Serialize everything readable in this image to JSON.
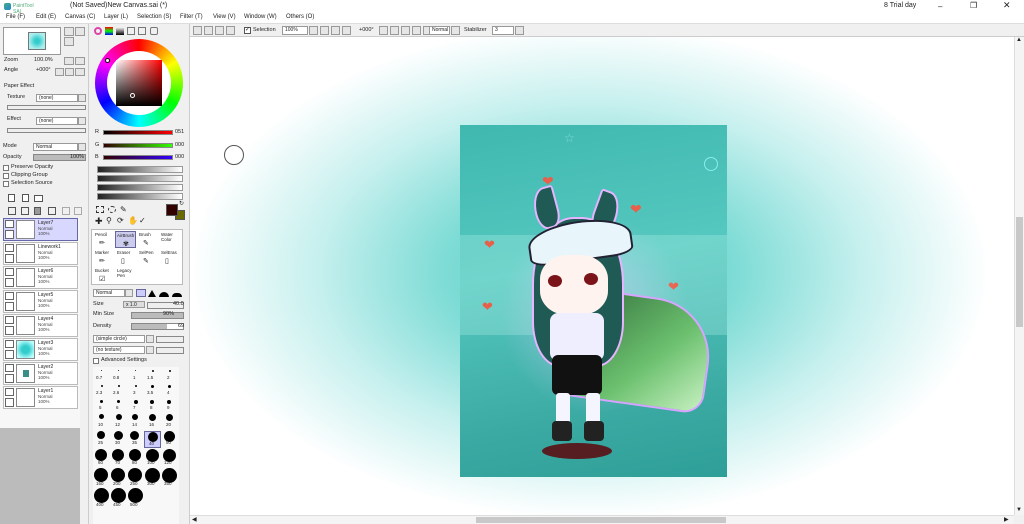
{
  "window": {
    "app_logo": "PaintTool SAI",
    "title": "(Not Saved)New Canvas.sai (*)",
    "trial": "8 Trial day"
  },
  "menu": [
    "File (F)",
    "Edit (E)",
    "Canvas (C)",
    "Layer (L)",
    "Selection (S)",
    "Filter (T)",
    "View (V)",
    "Window (W)",
    "Others (O)"
  ],
  "navigator": {
    "zoom_label": "Zoom",
    "zoom_value": "100.0%",
    "angle_label": "Angle",
    "angle_value": "+000°"
  },
  "paper_effect": {
    "header": "Paper Effect",
    "texture_label": "Texture",
    "texture_value": "(none)",
    "effect_label": "Effect",
    "effect_value": "(none)"
  },
  "layer_props": {
    "mode_label": "Mode",
    "mode_value": "Normal",
    "opacity_label": "Opacity",
    "opacity_value": "100%",
    "preserve_opacity": "Preserve Opacity",
    "clipping_group": "Clipping Group",
    "selection_source": "Selection Source"
  },
  "layers": [
    {
      "name": "Layer7",
      "mode": "Normal",
      "opacity": "100%",
      "selected": true
    },
    {
      "name": "Linework1",
      "mode": "Normal",
      "opacity": "100%"
    },
    {
      "name": "Layer6",
      "mode": "Normal",
      "opacity": "100%"
    },
    {
      "name": "Layer5",
      "mode": "Normal",
      "opacity": "100%"
    },
    {
      "name": "Layer4",
      "mode": "Normal",
      "opacity": "100%"
    },
    {
      "name": "Layer3",
      "mode": "Normal",
      "opacity": "100%"
    },
    {
      "name": "Layer2",
      "mode": "Normal",
      "opacity": "100%"
    },
    {
      "name": "Layer1",
      "mode": "Normal",
      "opacity": "100%"
    }
  ],
  "color": {
    "r_label": "R",
    "r_value": "051",
    "g_label": "G",
    "g_value": "000",
    "b_label": "B",
    "b_value": "000",
    "fg": "#330000"
  },
  "tools": [
    [
      "Pencil",
      "AirBrush",
      "Brush",
      "Water Color"
    ],
    [
      "Marker",
      "Eraser",
      "SelPen",
      "SelEras"
    ],
    [
      "Bucket",
      "Legacy Pen"
    ]
  ],
  "brush": {
    "mode_value": "Normal",
    "size_label": "Size",
    "size_mult": "x 1.0",
    "size_value": "40.0",
    "min_size_label": "Min Size",
    "min_size_value": "90%",
    "density_label": "Density",
    "density_value": "69",
    "shape_value": "(simple circle)",
    "texture_value": "(no texture)",
    "advanced": "Advanced Settings"
  },
  "brush_sizes": [
    [
      "0.7",
      "0.8",
      "1",
      "1.5",
      "2"
    ],
    [
      "2.3",
      "2.6",
      "3",
      "3.5",
      "4"
    ],
    [
      "5",
      "6",
      "7",
      "8",
      "9"
    ],
    [
      "10",
      "12",
      "14",
      "16",
      "20"
    ],
    [
      "25",
      "30",
      "35",
      "40",
      "50"
    ],
    [
      "60",
      "70",
      "80",
      "100",
      "120"
    ],
    [
      "160",
      "200",
      "250",
      "300",
      "350"
    ],
    [
      "400",
      "450",
      "500"
    ]
  ],
  "toolbar": {
    "selection_label": "Selection",
    "zoom_value": "100%",
    "angle_value": "+000°",
    "mode_value": "Normal",
    "stabilizer_label": "Stabilizer",
    "stabilizer_value": "3"
  },
  "colors": {
    "canvas_bg": "#9fe6e4",
    "canvas_teal": "#4fc8bf",
    "heart": "#e8604a"
  }
}
